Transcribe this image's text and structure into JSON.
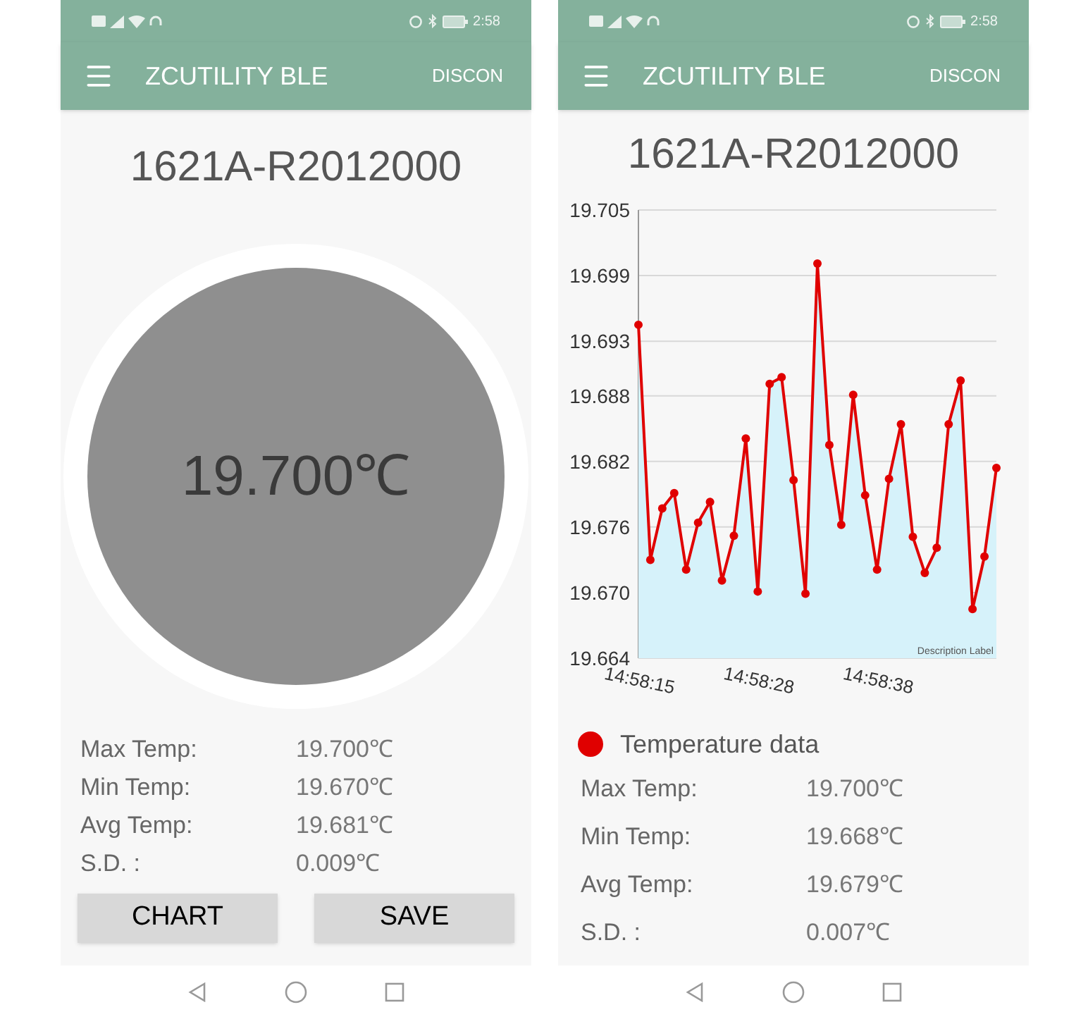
{
  "screens": [
    {
      "kind": "gauge",
      "status_bar": {
        "time": "2:58"
      },
      "app_bar": {
        "title": "ZCUTILITY BLE",
        "action": "DISCON"
      },
      "device_name": "1621A-R2012000",
      "gauge": {
        "reading": "19.700℃"
      },
      "stats": [
        {
          "label": "Max Temp:",
          "value": "19.700℃"
        },
        {
          "label": "Min Temp:",
          "value": "19.670℃"
        },
        {
          "label": "Avg Temp:",
          "value": "19.681℃"
        },
        {
          "label": "S.D. :",
          "value": "0.009℃"
        }
      ],
      "buttons": [
        "CHART",
        "SAVE"
      ]
    },
    {
      "kind": "chart",
      "status_bar": {
        "time": "2:58"
      },
      "app_bar": {
        "title": "ZCUTILITY BLE",
        "action": "DISCON"
      },
      "device_name": "1621A-R2012000",
      "chart_description": "Description Label",
      "chart_data": {
        "type": "area",
        "categories": [
          "14:58:15",
          null,
          null,
          null,
          null,
          null,
          null,
          null,
          null,
          null,
          "14:58:28",
          null,
          null,
          null,
          null,
          null,
          null,
          null,
          null,
          null,
          "14:58:38",
          null,
          null,
          null,
          null,
          null,
          null,
          null,
          null,
          null,
          null
        ],
        "series": [
          {
            "name": "Temperature data",
            "color": "#e00000",
            "values": [
              19.6945,
              19.673,
              19.6777,
              19.6791,
              19.6721,
              19.6764,
              19.6783,
              19.6711,
              19.6752,
              19.6841,
              19.6701,
              19.6891,
              19.6897,
              19.6803,
              19.6699,
              19.7001,
              19.6835,
              19.6762,
              19.6881,
              19.6789,
              19.6721,
              19.6804,
              19.6854,
              19.6751,
              19.6718,
              19.6741,
              19.6854,
              19.6894,
              19.6685,
              19.6733,
              19.6814
            ]
          }
        ],
        "ylim": [
          19.664,
          19.705
        ],
        "grid": true,
        "yticks": [
          {
            "value": 19.664,
            "label": "19.664"
          },
          {
            "value": 19.67,
            "label": "19.670"
          },
          {
            "value": 19.676,
            "label": "19.676"
          },
          {
            "value": 19.682,
            "label": "19.682"
          },
          {
            "value": 19.688,
            "label": "19.688"
          },
          {
            "value": 19.693,
            "label": "19.693"
          },
          {
            "value": 19.699,
            "label": "19.699"
          },
          {
            "value": 19.705,
            "label": "19.705"
          }
        ]
      },
      "stats": [
        {
          "label": "Max Temp:",
          "value": "19.700℃"
        },
        {
          "label": "Min Temp:",
          "value": "19.668℃"
        },
        {
          "label": "Avg Temp:",
          "value": "19.679℃"
        },
        {
          "label": "S.D. :",
          "value": "0.007℃"
        }
      ]
    }
  ]
}
